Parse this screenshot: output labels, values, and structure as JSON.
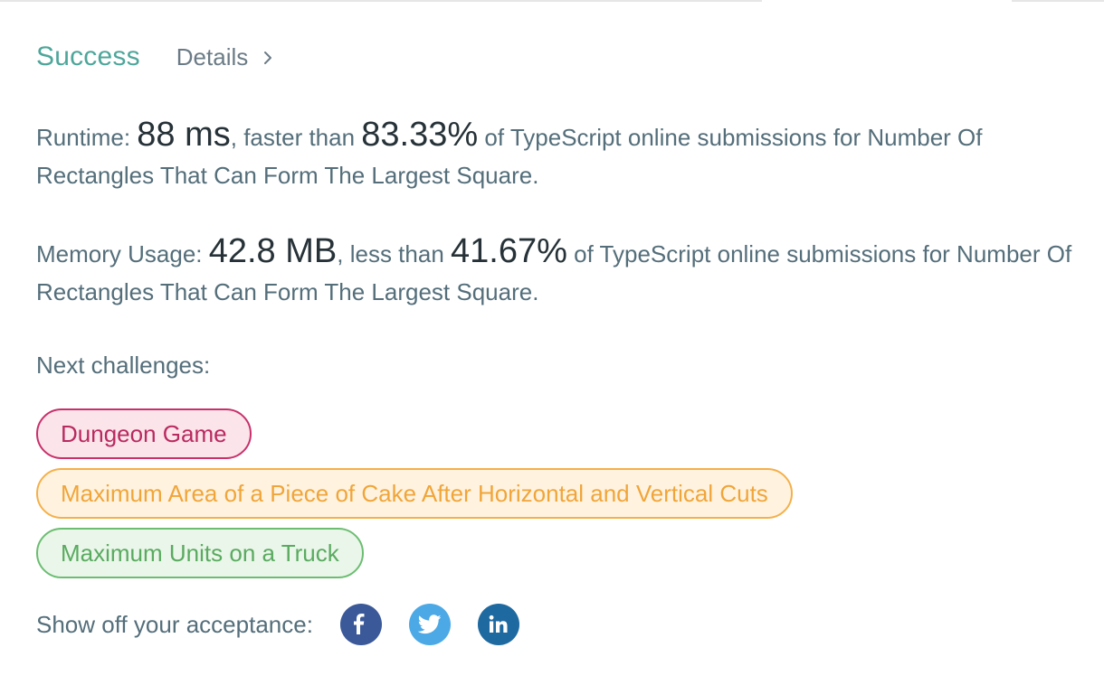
{
  "header": {
    "status": "Success",
    "details_label": "Details"
  },
  "runtime": {
    "label": "Runtime: ",
    "value": "88 ms",
    "connector": ", faster than ",
    "percentile": "83.33%",
    "suffix": " of TypeScript online submissions for Number Of Rectangles That Can Form The Largest Square."
  },
  "memory": {
    "label": "Memory Usage: ",
    "value": "42.8 MB",
    "connector": ", less than ",
    "percentile": "41.67%",
    "suffix": " of TypeScript online submissions for Number Of Rectangles That Can Form The Largest Square."
  },
  "next": {
    "label": "Next challenges:",
    "challenges": [
      {
        "title": "Dungeon Game",
        "difficulty": "hard"
      },
      {
        "title": "Maximum Area of a Piece of Cake After Horizontal and Vertical Cuts",
        "difficulty": "medium"
      },
      {
        "title": "Maximum Units on a Truck",
        "difficulty": "easy"
      }
    ]
  },
  "share": {
    "label": "Show off your acceptance:",
    "icons": [
      "facebook-icon",
      "twitter-icon",
      "linkedin-icon"
    ]
  },
  "colors": {
    "success": "#4ea69a",
    "hard": "#c8306a",
    "medium": "#f4b04a",
    "easy": "#6cbd72",
    "facebook": "#3b5998",
    "twitter": "#4ca9e6",
    "linkedin": "#1e6aa0"
  }
}
